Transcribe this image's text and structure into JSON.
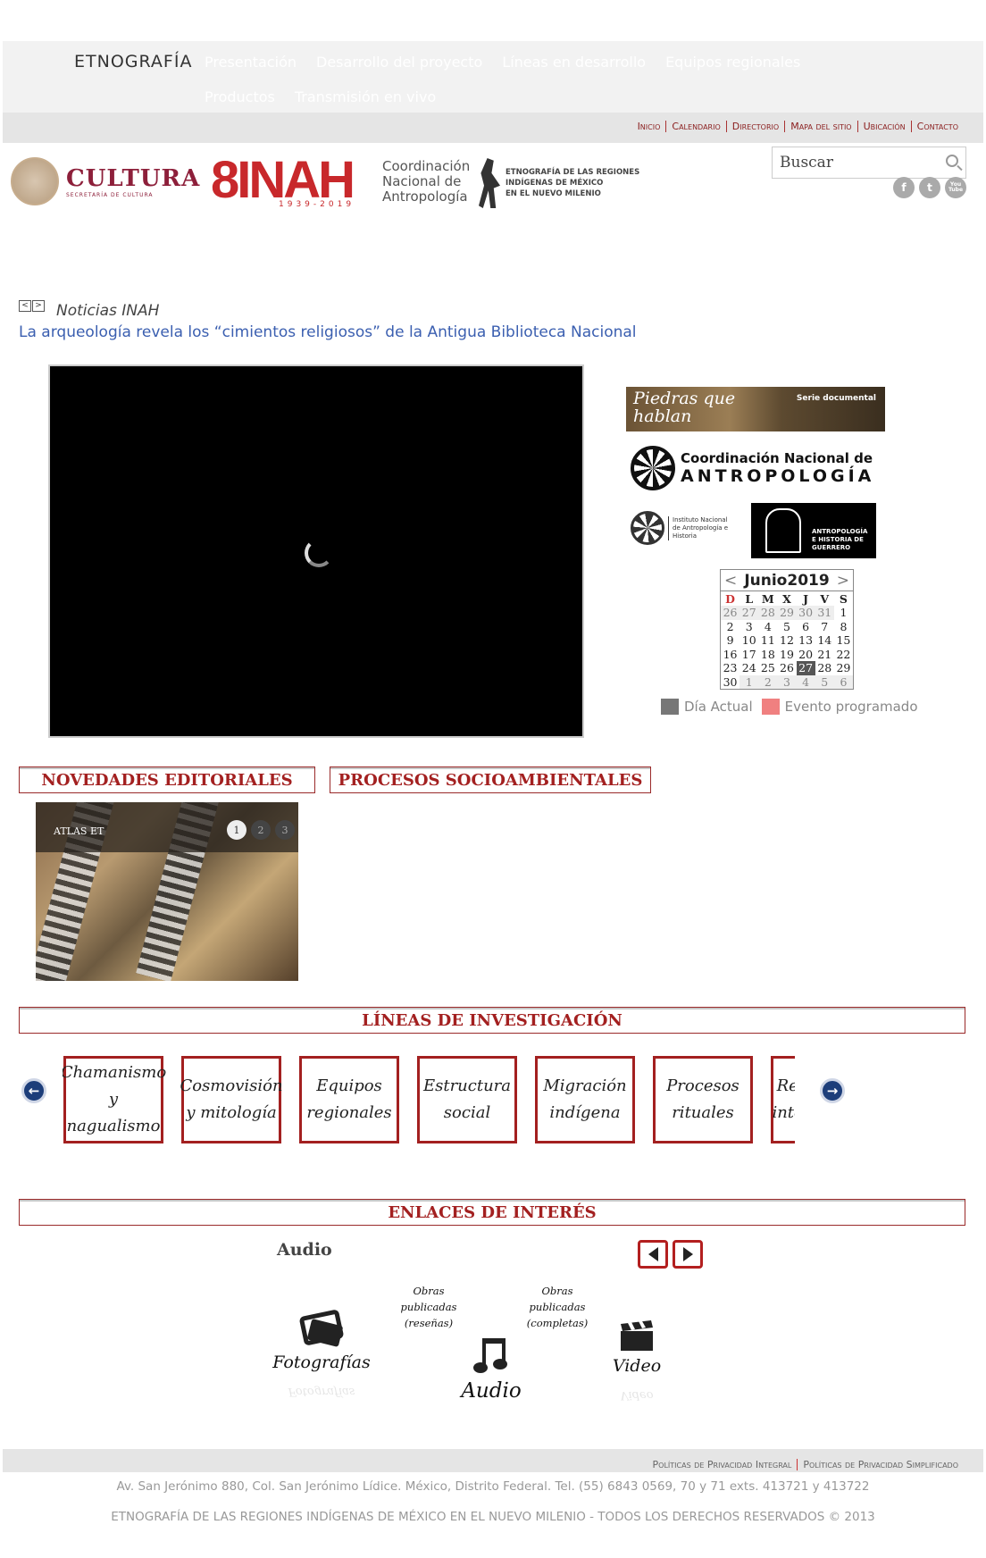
{
  "nav": {
    "brand": "ETNOGRAFÍA",
    "menu": [
      "Presentación",
      "Desarrollo del proyecto",
      "Líneas en desarrollo",
      "Equipos regionales",
      "Productos",
      "Transmisión en vivo"
    ]
  },
  "util_links": [
    "Inicio",
    "Calendario",
    "Directorio",
    "Mapa del sitio",
    "Ubicación",
    "Contacto"
  ],
  "logos": {
    "cultura_word": "CULTURA",
    "cultura_sub": "SECRETARÍA DE CULTURA",
    "inah_word": "8INAH",
    "inah_years": "1939-2019",
    "cna_lines": [
      "Coordinación",
      "Nacional de",
      "Antropología"
    ],
    "etno_lines": [
      "ETNOGRAFÍA DE LAS REGIONES",
      "INDÍGENAS DE MÉXICO",
      "EN EL NUEVO MILENIO"
    ]
  },
  "search": {
    "placeholder": "Buscar"
  },
  "social": [
    "f",
    "t",
    "You Tube"
  ],
  "ticker": {
    "prev": "<",
    "next": ">",
    "heading": "Noticias INAH",
    "headline": "La arqueología revela los “cimientos religiosos” de la Antigua Biblioteca Nacional"
  },
  "banners": {
    "piedras_title": "Piedras que hablan",
    "piedras_tag": "Serie documental",
    "cna_line1": "Coordinación Nacional de",
    "cna_line2": "ANTROPOLOGÍA",
    "inah_small": "Instituto Nacional de Antropología e Historia",
    "guerrero": "ANTROPOLOGÍA E HISTORIA DE GUERRERO"
  },
  "calendar": {
    "month": "Junio",
    "year": "2019",
    "prev": "<",
    "next": ">",
    "days": [
      "D",
      "L",
      "M",
      "X",
      "J",
      "V",
      "S"
    ],
    "weeks": [
      [
        {
          "d": "26",
          "o": true
        },
        {
          "d": "27",
          "o": true
        },
        {
          "d": "28",
          "o": true
        },
        {
          "d": "29",
          "o": true
        },
        {
          "d": "30",
          "o": true
        },
        {
          "d": "31",
          "o": true
        },
        {
          "d": "1"
        }
      ],
      [
        {
          "d": "2"
        },
        {
          "d": "3"
        },
        {
          "d": "4"
        },
        {
          "d": "5"
        },
        {
          "d": "6"
        },
        {
          "d": "7"
        },
        {
          "d": "8"
        }
      ],
      [
        {
          "d": "9"
        },
        {
          "d": "10"
        },
        {
          "d": "11"
        },
        {
          "d": "12"
        },
        {
          "d": "13"
        },
        {
          "d": "14"
        },
        {
          "d": "15"
        }
      ],
      [
        {
          "d": "16"
        },
        {
          "d": "17"
        },
        {
          "d": "18"
        },
        {
          "d": "19"
        },
        {
          "d": "20"
        },
        {
          "d": "21"
        },
        {
          "d": "22"
        }
      ],
      [
        {
          "d": "23"
        },
        {
          "d": "24"
        },
        {
          "d": "25"
        },
        {
          "d": "26"
        },
        {
          "d": "27",
          "t": true
        },
        {
          "d": "28"
        },
        {
          "d": "29"
        }
      ],
      [
        {
          "d": "30"
        },
        {
          "d": "1",
          "o": true
        },
        {
          "d": "2",
          "o": true
        },
        {
          "d": "3",
          "o": true
        },
        {
          "d": "4",
          "o": true
        },
        {
          "d": "5",
          "o": true
        },
        {
          "d": "6",
          "o": true
        }
      ]
    ],
    "legend_today": "Día Actual",
    "legend_event": "Evento programado",
    "color_today": "#777777",
    "color_event": "#f08080"
  },
  "sections": {
    "novedades": "NOVEDADES EDITORIALES",
    "procesos": "PROCESOS SOCIOAMBIENTALES",
    "lineas": "LÍNEAS DE INVESTIGACIÓN",
    "enlaces": "ENLACES DE INTERÉS"
  },
  "slider": {
    "caption": "ATLAS ET",
    "dots": [
      "1",
      "2",
      "3"
    ]
  },
  "research_lines": [
    "Chamanismo y nagualismo",
    "Cosmovisión y mitología",
    "Equipos regionales",
    "Estructura social",
    "Migración indígena",
    "Procesos rituales",
    "Relaciones interétnicas"
  ],
  "enlaces": {
    "current": "Audio",
    "items": {
      "fotos": "Fotografías",
      "resenas": "Obras publicadas (reseñas)",
      "completas": "Obras publicadas (completas)",
      "audio": "Audio",
      "video": "Video"
    }
  },
  "footer": {
    "links": [
      "Políticas de Privacidad Integral",
      "Políticas de Privacidad Simplificado"
    ],
    "address": "Av. San Jerónimo 880, Col. San Jerónimo Lídice. México, Distrito Federal.  Tel. (55) 6843 0569, 70 y 71 exts. 413721 y 413722",
    "copyright": "ETNOGRAFÍA DE LAS REGIONES INDÍGENAS DE MÉXICO EN EL NUEVO MILENIO - TODOS LOS DERECHOS RESERVADOS © 2013"
  },
  "colors": {
    "accent": "#a32020",
    "link": "#3b5fb0"
  }
}
